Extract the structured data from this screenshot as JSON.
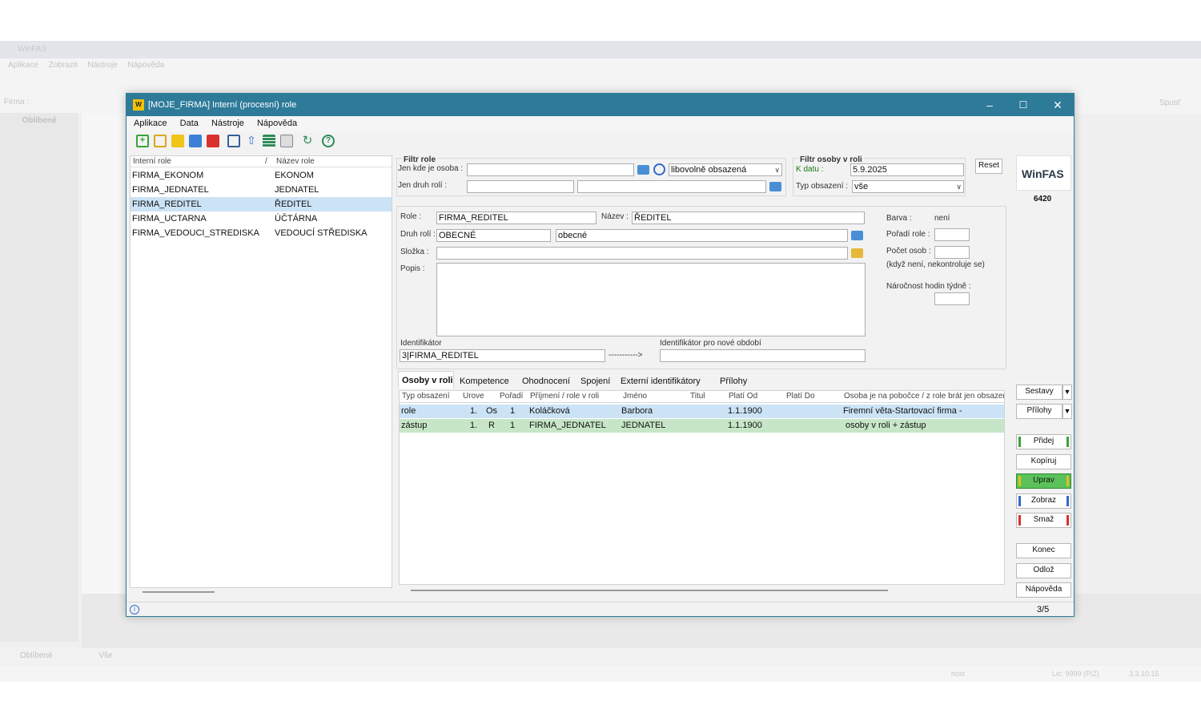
{
  "bg": {
    "app_title": "WinFAS",
    "menu": [
      "Aplikace",
      "Zobrazit",
      "Nástroje",
      "Nápověda"
    ],
    "firma_label": "Firma :",
    "left_tab": "Oblíbené",
    "right_button": "Spusť",
    "bottom_tabs": [
      "Oblíbené",
      "Vše"
    ],
    "status_user": "host",
    "status_lic": "Lic: 9999 (P/Z)",
    "status_version": "3.3.10.15"
  },
  "win": {
    "title": "[MOJE_FIRMA] Interní (procesní) role",
    "logo_letter": "W",
    "menu": [
      "Aplikace",
      "Data",
      "Nástroje",
      "Nápověda"
    ]
  },
  "list": {
    "headers": [
      "Interní role",
      "/",
      "Název role"
    ],
    "rows": [
      {
        "code": "FIRMA_EKONOM",
        "name": "EKONOM"
      },
      {
        "code": "FIRMA_JEDNATEL",
        "name": "JEDNATEL"
      },
      {
        "code": "FIRMA_REDITEL",
        "name": "ŘEDITEL"
      },
      {
        "code": "FIRMA_UCTARNA",
        "name": "ÚČTÁRNA"
      },
      {
        "code": "FIRMA_VEDOUCI_STREDISKA",
        "name": "VEDOUCÍ STŘEDISKA"
      }
    ],
    "selected_index": 2
  },
  "filtr_role": {
    "title": "Filtr role",
    "osoba_label": "Jen kde je osoba :",
    "osoba_value": "",
    "obsazeni_value": "libovolně obsazená",
    "druh_label": "Jen druh rolí :",
    "druh_code": "",
    "druh_name": ""
  },
  "filtr_osoby": {
    "title": "Filtr osoby v roli",
    "datum_label": "K datu :",
    "datum_value": "5.9.2025",
    "typ_label": "Typ obsazení :",
    "typ_value": "vše"
  },
  "reset_label": "Reset",
  "brand": {
    "name": "WinFAS",
    "code": "6420"
  },
  "detail": {
    "role_label": "Role :",
    "role_value": "FIRMA_REDITEL",
    "nazev_label": "Název :",
    "nazev_value": "ŘEDITEL",
    "druh_label": "Druh rolí :",
    "druh_code": "OBECNÉ",
    "druh_name": "obecné",
    "slozka_label": "Složka :",
    "slozka_value": "",
    "popis_label": "Popis :",
    "popis_value": "",
    "ident_label": "Identifikátor",
    "ident_value": "3|FIRMA_REDITEL",
    "arrow": "----------->",
    "ident_new_label": "Identifikátor pro nové období",
    "ident_new_value": "",
    "barva_label": "Barva :",
    "barva_value": "není",
    "poradi_label": "Pořadí role :",
    "pocet_label": "Počet osob :",
    "pocet_note": "(když není, nekontroluje se)",
    "narocnost_label": "Náročnost hodin týdně :"
  },
  "tabs": [
    "Osoby v roli",
    "Kompetence",
    "Ohodnocení",
    "Spojení",
    "Externí identifikátory",
    "Přílohy"
  ],
  "grid": {
    "headers": [
      "Typ obsazení",
      "Úroveň",
      "",
      "Pořadí",
      "Příjmení / role v roli",
      "Jméno",
      "Titul",
      "Platí Od",
      "Platí Do",
      "Osoba je na pobočce / z role brát jen obsazení"
    ],
    "rows": [
      {
        "typ": "role",
        "uroven": "1.",
        "znak": "Os",
        "poradi": "1",
        "prijmeni": "Koláčková",
        "jmeno": "Barbora",
        "titul": "",
        "od": "1.1.1900",
        "do": "",
        "pobocka": "Firemní věta-Startovací firma  -"
      },
      {
        "typ": "zástup",
        "uroven": "1.",
        "znak": "R",
        "poradi": "1",
        "prijmeni": "FIRMA_JEDNATEL",
        "jmeno": "JEDNATEL",
        "titul": "",
        "od": "1.1.1900",
        "do": "",
        "pobocka": "osoby v roli + zástup"
      }
    ]
  },
  "buttons": {
    "sestavy": "Sestavy",
    "prilohy": "Přílohy",
    "pridej": "Přidej",
    "kopiruj": "Kopíruj",
    "uprav": "Uprav",
    "zobraz": "Zobraz",
    "smaz": "Smaž",
    "konec": "Konec",
    "odloz": "Odlož",
    "napoveda": "Nápověda"
  },
  "status": {
    "info": "i",
    "position": "3/5"
  },
  "colors": {
    "titlebar": "#2d7a99",
    "selected_row": "#cce3f6",
    "zastup_row": "#c7e6c7",
    "role_row": "#cce3f6",
    "add_green": "#3aa33a",
    "edit_yellow": "#e0c21a",
    "view_blue": "#2f6ad0",
    "delete_red": "#d93030"
  }
}
